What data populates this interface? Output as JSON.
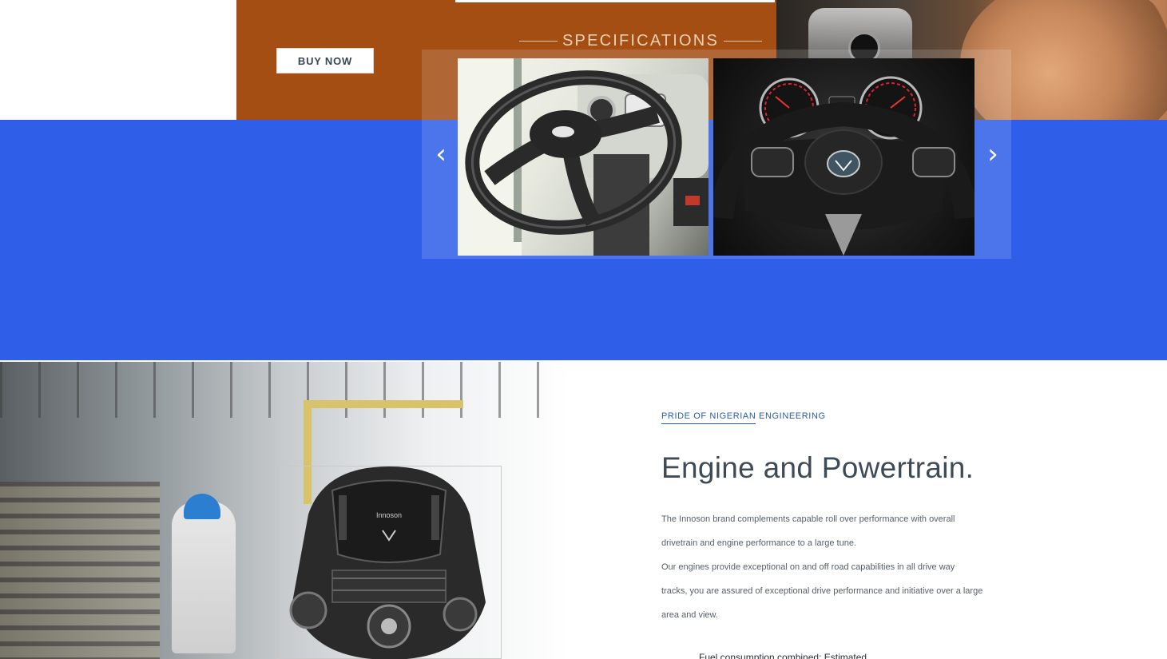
{
  "hero": {
    "buy_now_label": "BUY NOW",
    "specifications_heading": "SPECIFICATIONS"
  },
  "carousel": {
    "prev_arrow": "‹",
    "next_arrow": "›",
    "slides": [
      {
        "icon": "steering-wheel-bus-image"
      },
      {
        "icon": "steering-wheel-suv-image"
      }
    ]
  },
  "engine_section": {
    "eyebrow": "PRIDE OF NIGERIAN ENGINEERING",
    "title": "Engine and Powertrain.",
    "paragraph_lines": [
      "The Innoson brand complements capable roll over performance with overall",
      "drivetrain and engine performance to a large tune.",
      "Our engines provide exceptional on and off road capabilities in all drive way",
      "tracks, you are assured of exceptional drive performance and initiative over a large",
      "area and view."
    ],
    "engine_badge": "Innoson",
    "cutoff_text": "Fuel consumption combined: Estimated"
  },
  "colors": {
    "orange_band": "#a44e14",
    "blue_band": "#2f5fe8",
    "accent_link": "#2b5aa8",
    "headline": "#3e4a57"
  }
}
